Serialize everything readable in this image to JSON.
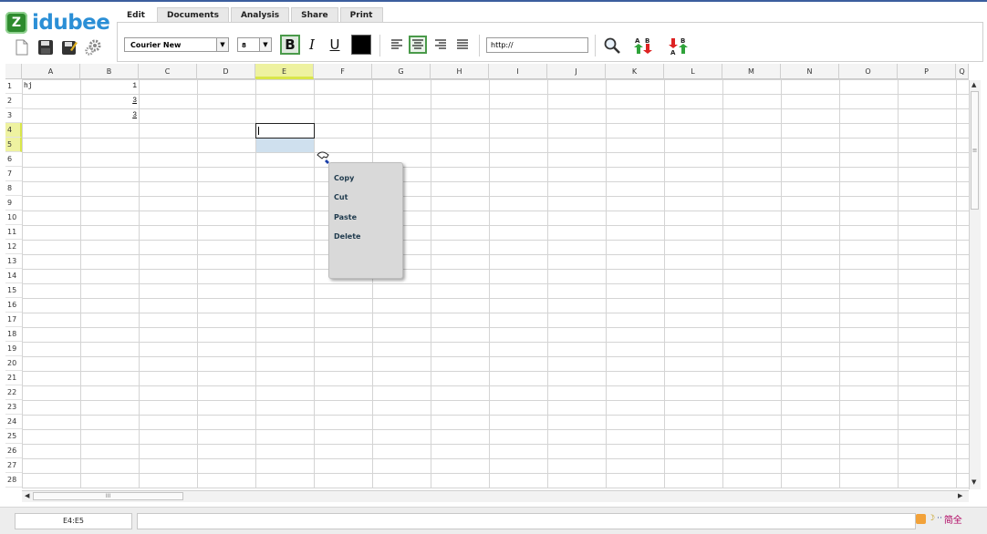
{
  "app": {
    "name": "idubee",
    "logo_mark": "Z"
  },
  "tabs": [
    {
      "label": "Edit",
      "active": true
    },
    {
      "label": "Documents",
      "active": false
    },
    {
      "label": "Analysis",
      "active": false
    },
    {
      "label": "Share",
      "active": false
    },
    {
      "label": "Print",
      "active": false
    }
  ],
  "toolbar": {
    "font_family": "Courier New",
    "font_size": "8",
    "bold": "B",
    "italic": "I",
    "underline": "U",
    "text_color": "#000000",
    "url_value": "http://"
  },
  "columns": [
    "A",
    "B",
    "C",
    "D",
    "E",
    "F",
    "G",
    "H",
    "I",
    "J",
    "K",
    "L",
    "M",
    "N",
    "O",
    "P",
    "Q"
  ],
  "rows": [
    "1",
    "2",
    "3",
    "4",
    "5",
    "6",
    "7",
    "8",
    "9",
    "10",
    "11",
    "12",
    "13",
    "14",
    "15",
    "16",
    "17",
    "18",
    "19",
    "20",
    "21",
    "22",
    "23",
    "24",
    "25",
    "26",
    "27",
    "28"
  ],
  "cells": {
    "A1": "hj",
    "B1": "1",
    "B2": "3",
    "B3": "3"
  },
  "selection": {
    "range": "E4:E5",
    "active_column": "E",
    "active_rows": [
      "4",
      "5"
    ]
  },
  "context_menu": {
    "items": [
      "Copy",
      "Cut",
      "Paste",
      "Delete"
    ]
  },
  "status": {
    "range_label": "E4:E5",
    "formula": ""
  },
  "scroll": {
    "h_thumb_label": "III",
    "v_thumb_label": "≡"
  },
  "ime": {
    "label": "简全"
  },
  "colors": {
    "accent": "#2b8fd6",
    "selection_header": "#eef2a0",
    "selected_cell": "#cfe0ee",
    "active_button_border": "#4a9a4a"
  }
}
